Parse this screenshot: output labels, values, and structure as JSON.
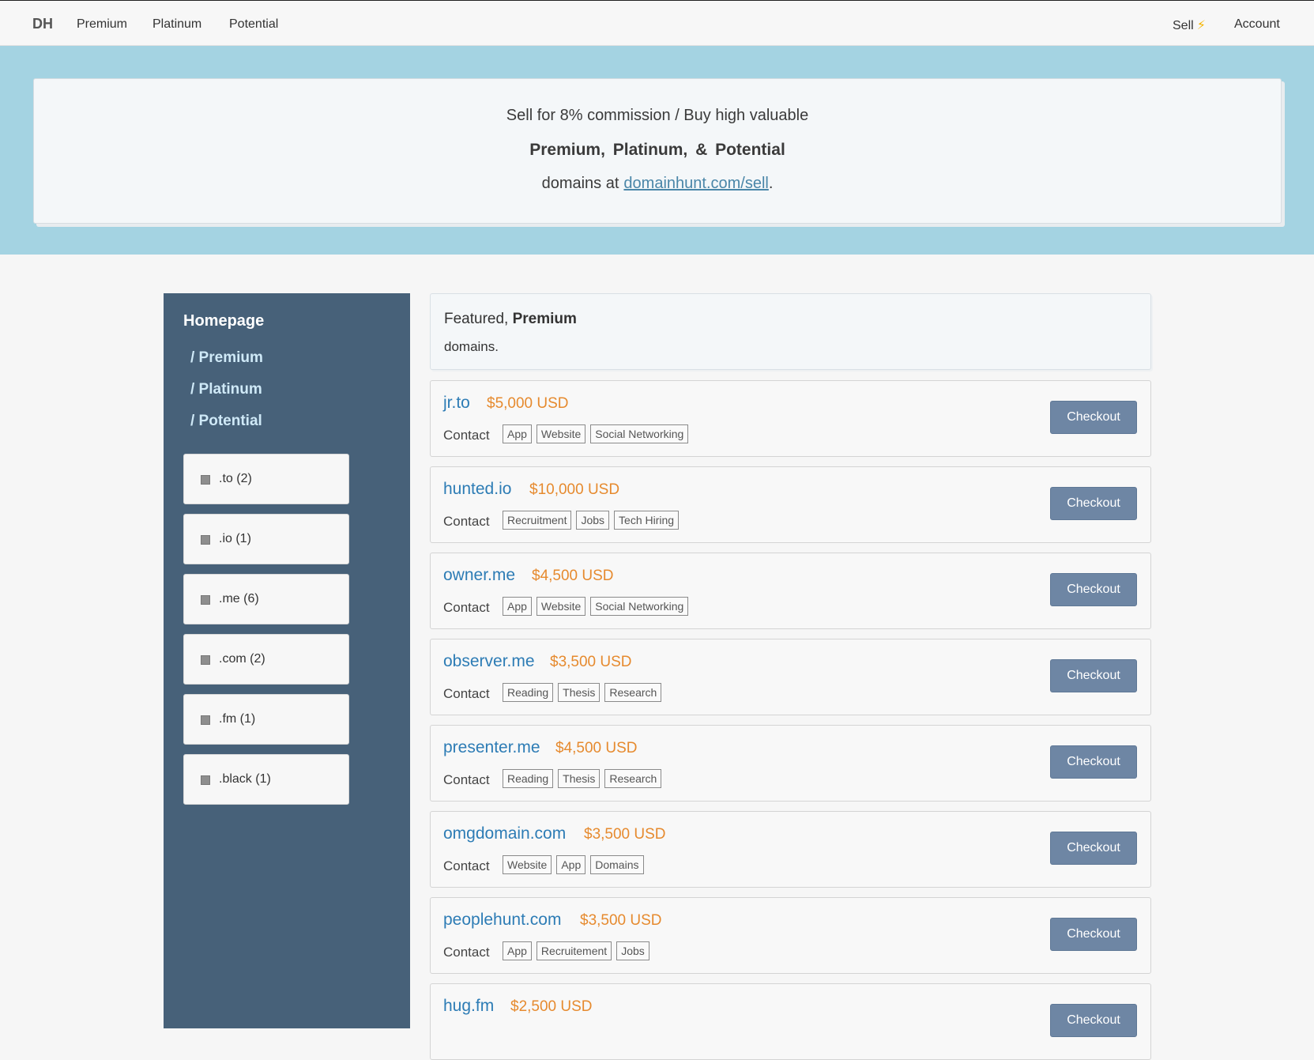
{
  "nav": {
    "brand": "DH",
    "links": [
      "Premium",
      "Platinum",
      "Potential"
    ],
    "sell": "Sell",
    "sell_icon": "⚡",
    "account": "Account"
  },
  "hero": {
    "line1": "Sell for 8% commission / Buy high valuable",
    "line2": "Premium,  Platinum,  &  Potential",
    "line3_prefix": "domains at",
    "line3_link": "domainhunt.com/sell",
    "line3_suffix": "."
  },
  "sidebar": {
    "home": "Homepage",
    "categories": [
      "/ Premium",
      "/ Platinum",
      "/ Potential"
    ],
    "tlds": [
      ".to (2)",
      ".io (1)",
      ".me (6)",
      ".com (2)",
      ".fm (1)",
      ".black (1)"
    ]
  },
  "featured": {
    "prefix": "Featured, ",
    "bold": "Premium",
    "line2": "domains."
  },
  "domains": [
    {
      "name": "jr.to",
      "price": "$5,000 USD",
      "contact": "Contact",
      "tags": [
        "App",
        "Website",
        "Social Networking"
      ],
      "button": "Checkout"
    },
    {
      "name": "hunted.io",
      "price": "$10,000 USD",
      "contact": "Contact",
      "tags": [
        "Recruitment",
        "Jobs",
        "Tech Hiring"
      ],
      "button": "Checkout"
    },
    {
      "name": "owner.me",
      "price": "$4,500 USD",
      "contact": "Contact",
      "tags": [
        "App",
        "Website",
        "Social Networking"
      ],
      "button": "Checkout"
    },
    {
      "name": "observer.me",
      "price": "$3,500 USD",
      "contact": "Contact",
      "tags": [
        "Reading",
        "Thesis",
        "Research"
      ],
      "button": "Checkout"
    },
    {
      "name": "presenter.me",
      "price": "$4,500 USD",
      "contact": "Contact",
      "tags": [
        "Reading",
        "Thesis",
        "Research"
      ],
      "button": "Checkout"
    },
    {
      "name": "omgdomain.com",
      "price": "$3,500 USD",
      "contact": "Contact",
      "tags": [
        "Website",
        "App",
        "Domains"
      ],
      "button": "Checkout"
    },
    {
      "name": "peoplehunt.com",
      "price": "$3,500 USD",
      "contact": "Contact",
      "tags": [
        "App",
        "Recruitement",
        "Jobs"
      ],
      "button": "Checkout"
    },
    {
      "name": "hug.fm",
      "price": "$2,500 USD",
      "contact": "Contact",
      "tags": [],
      "button": "Checkout"
    }
  ],
  "colors": {
    "hero_bg": "#a4d3e2",
    "sidebar_bg": "#476179",
    "domain_link": "#2d7cb5",
    "price": "#e68a2e",
    "button": "#6e86a4"
  }
}
